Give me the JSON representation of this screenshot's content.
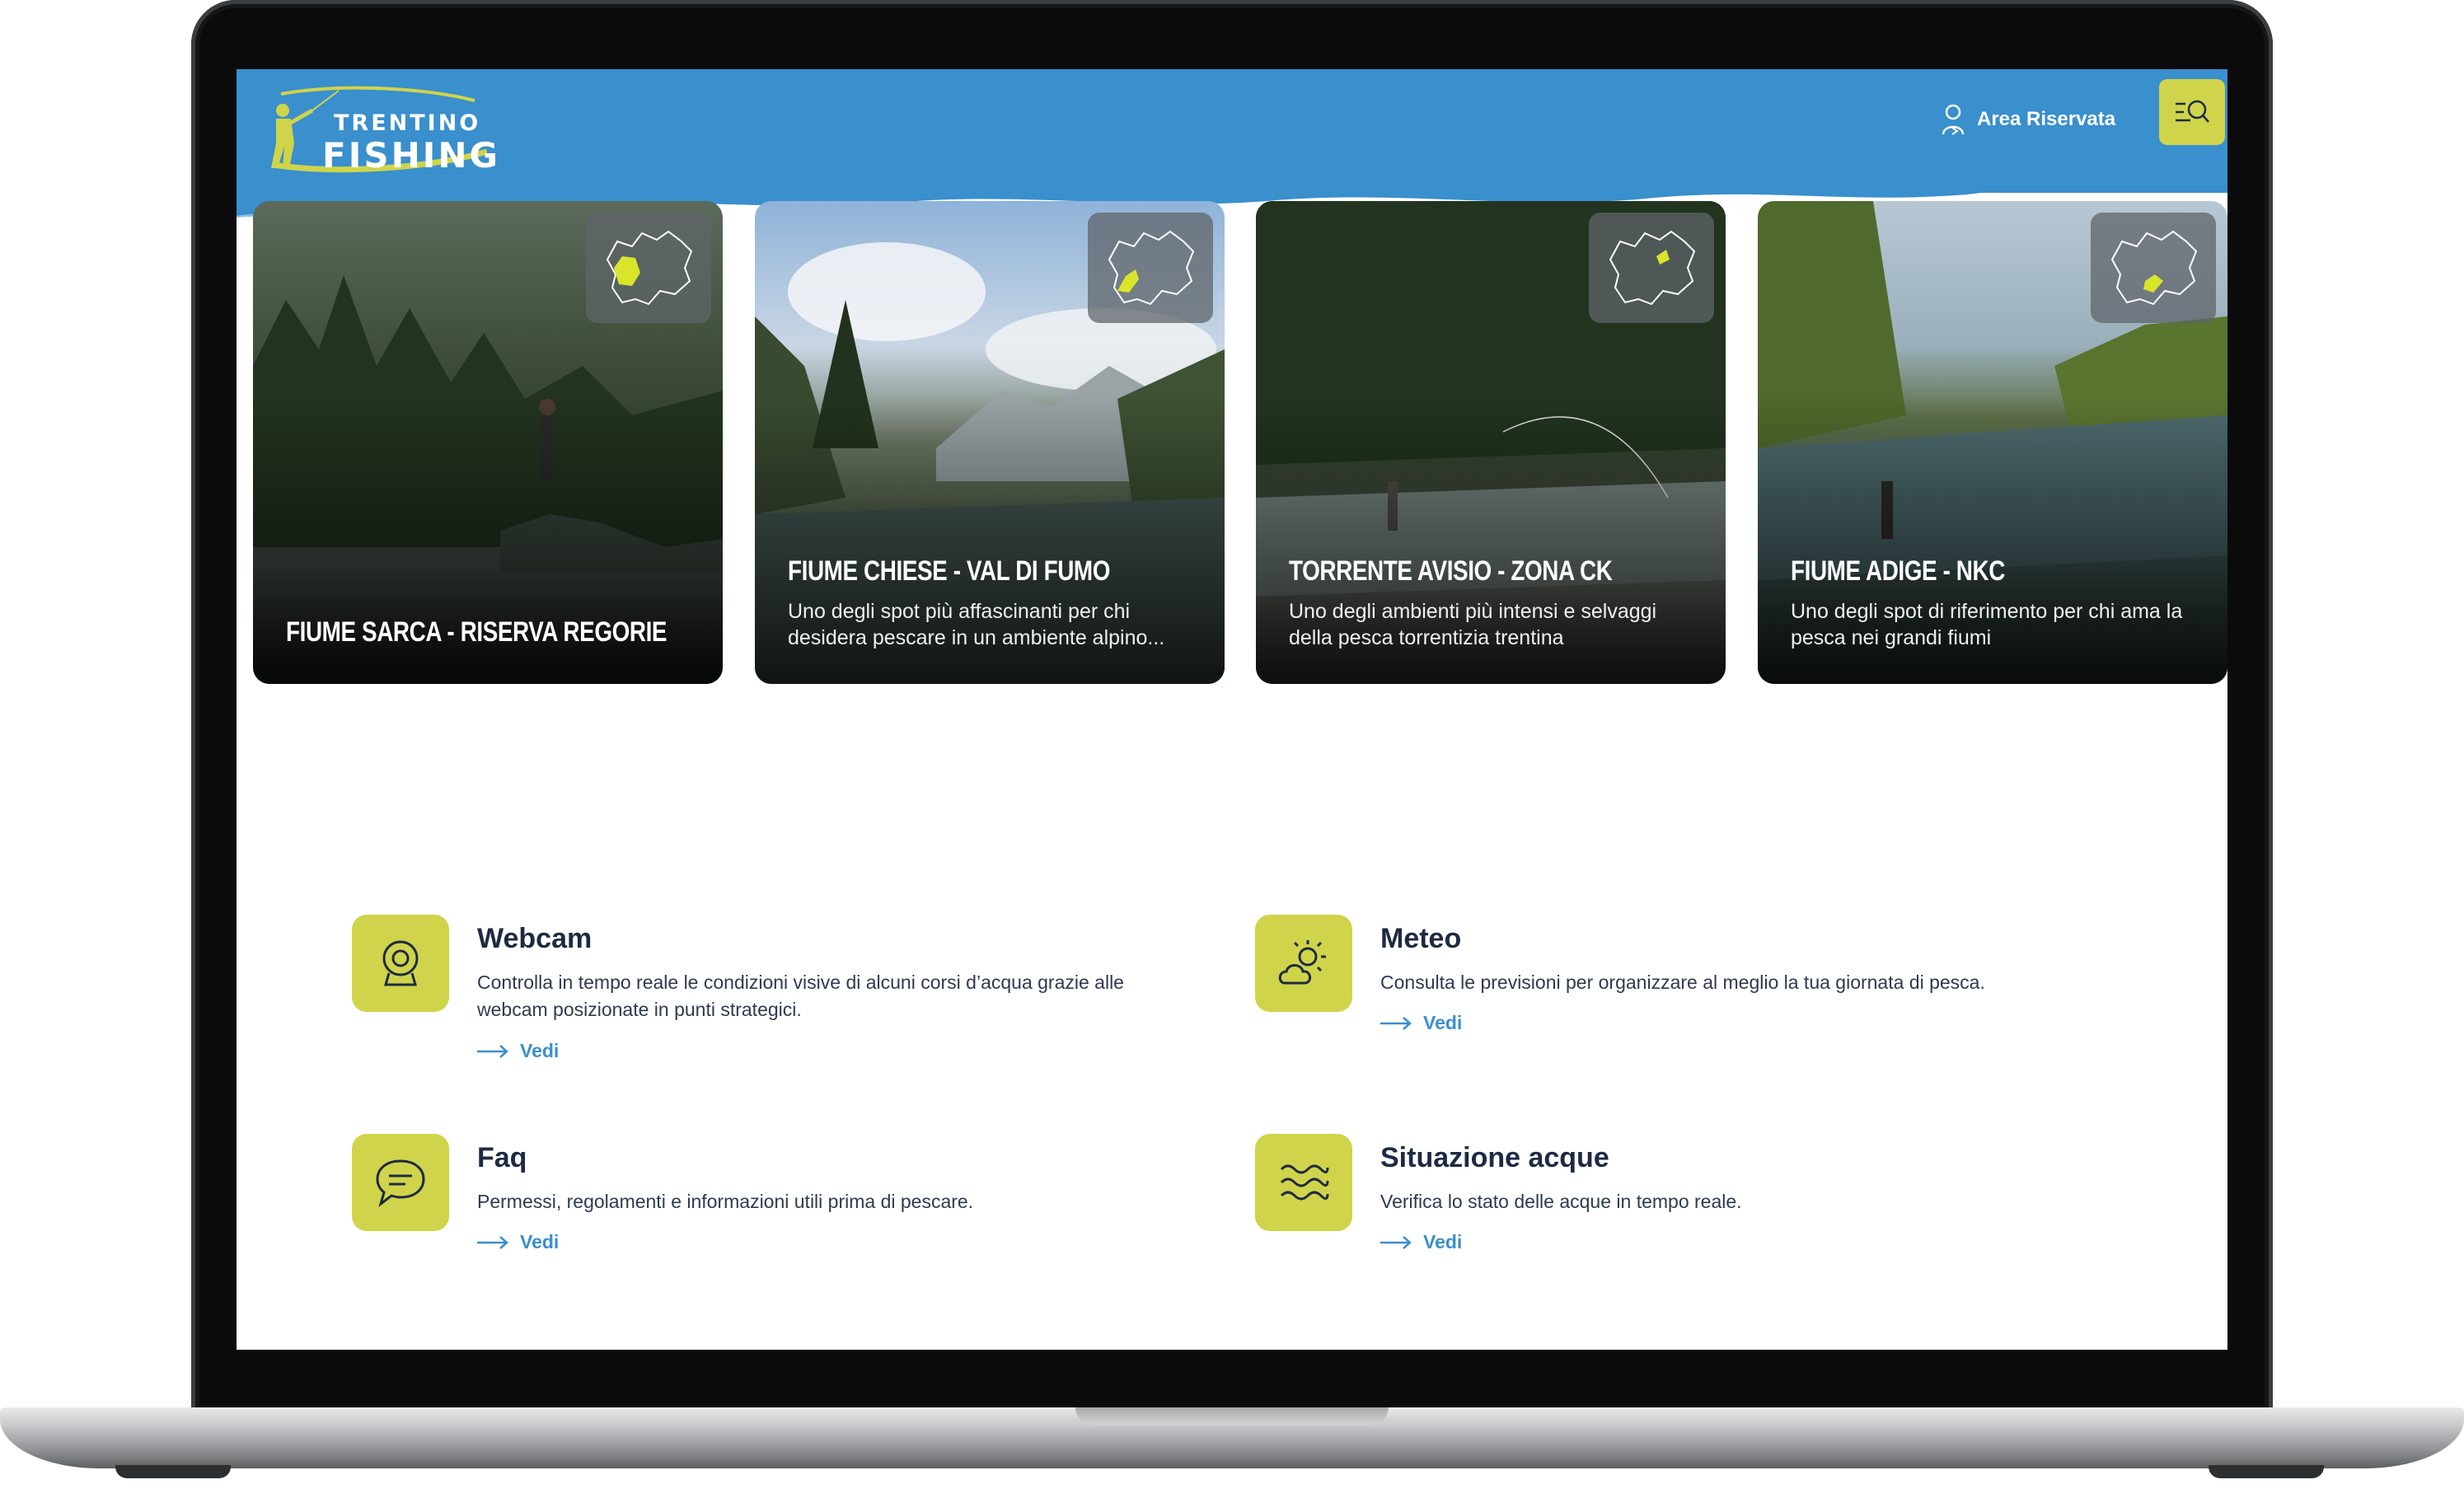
{
  "colors": {
    "header_blue": "#3a8fcd",
    "accent_lime": "#cfd44a",
    "text_dark": "#1e2a44",
    "link_blue": "#3a8fcd"
  },
  "header": {
    "logo_line1": "TRENTINO",
    "logo_line2": "FISHING",
    "area_riservata_label": "Area Riservata",
    "area_riservata_icon": "user-icon",
    "menu_icon": "menu-search-icon"
  },
  "cards": [
    {
      "title": "FIUME SARCA - RISERVA REGORIE",
      "description": ""
    },
    {
      "title": "FIUME CHIESE - VAL DI FUMO",
      "description": "Uno degli spot più affascinanti per chi desidera pescare in un ambiente alpino..."
    },
    {
      "title": "TORRENTE AVISIO - ZONA CK",
      "description": "Uno degli ambienti più intensi e selvaggi della pesca torrentizia trentina"
    },
    {
      "title": "FIUME ADIGE - NKC",
      "description": "Uno degli spot di riferimento per chi ama la pesca nei grandi fiumi"
    }
  ],
  "services": [
    {
      "title": "Webcam",
      "description": "Controlla in tempo reale le condizioni visive di alcuni corsi d’acqua grazie alle webcam posizionate in punti strategici.",
      "link": "Vedi",
      "icon": "webcam-icon"
    },
    {
      "title": "Meteo",
      "description": "Consulta le previsioni per organizzare al meglio la tua giornata di pesca.",
      "link": "Vedi",
      "icon": "weather-icon"
    },
    {
      "title": "Faq",
      "description": "Permessi, regolamenti e informazioni utili prima di pescare.",
      "link": "Vedi",
      "icon": "chat-bubble-icon"
    },
    {
      "title": "Situazione acque",
      "description": "Verifica lo stato delle acque in tempo reale.",
      "link": "Vedi",
      "icon": "waves-icon"
    }
  ]
}
